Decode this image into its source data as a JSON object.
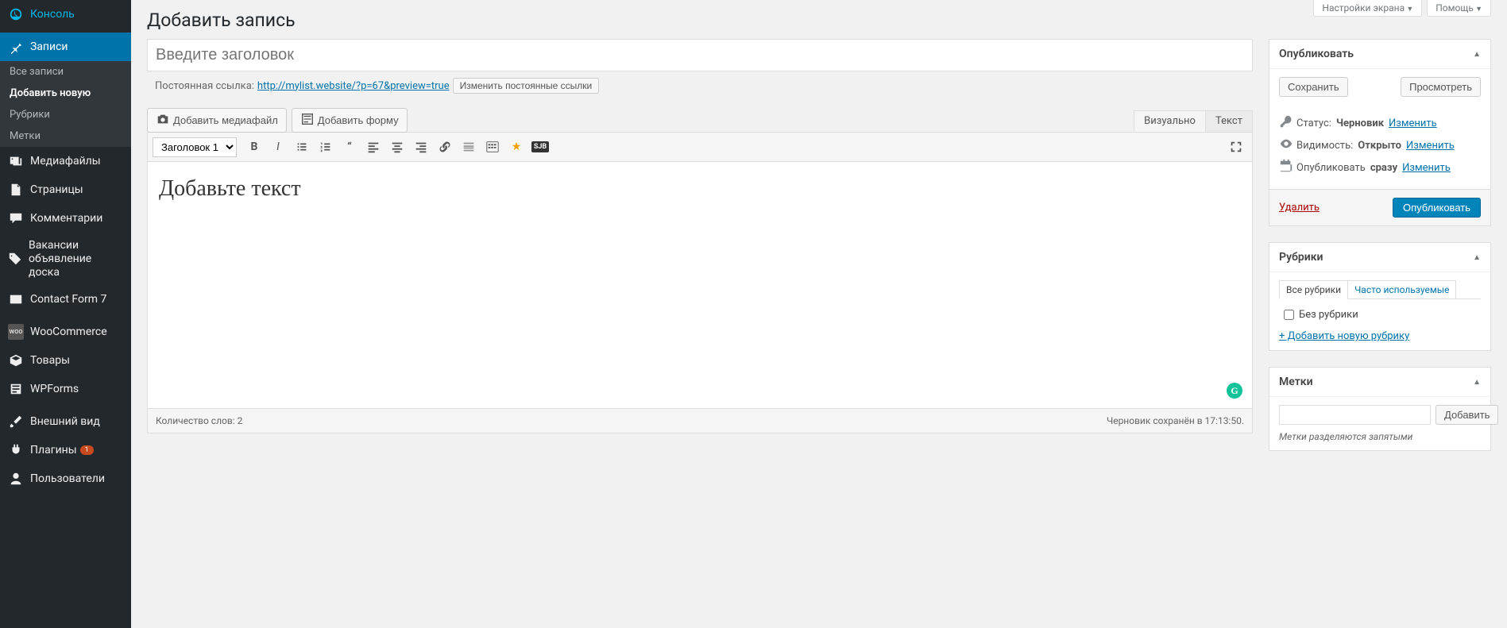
{
  "screen_meta": {
    "options": "Настройки экрана",
    "help": "Помощь"
  },
  "page_title": "Добавить запись",
  "sidebar": {
    "console": "Консоль",
    "posts": "Записи",
    "posts_sub": {
      "all": "Все записи",
      "add": "Добавить новую",
      "cats": "Рубрики",
      "tags": "Метки"
    },
    "media": "Медиафайлы",
    "pages": "Страницы",
    "comments": "Комментарии",
    "jobs": "Вакансии объявление доска",
    "cf7": "Contact Form 7",
    "woo": "WooCommerce",
    "products": "Товары",
    "wpforms": "WPForms",
    "appearance": "Внешний вид",
    "plugins": "Плагины",
    "plugins_badge": "1",
    "users": "Пользователи"
  },
  "title_placeholder": "Введите заголовок",
  "permalink": {
    "label": "Постоянная ссылка:",
    "url": "http://mylist.website/?p=67&preview=true",
    "edit_btn": "Изменить постоянные ссылки"
  },
  "media_buttons": {
    "add_media": "Добавить медиафайл",
    "add_form": "Добавить форму"
  },
  "editor_tabs": {
    "visual": "Визуально",
    "text": "Текст"
  },
  "format_select": "Заголовок 1",
  "editor_content": "Добавьте текст",
  "editor_status": {
    "words": "Количество слов: 2",
    "saved": "Черновик сохранён в 17:13:50."
  },
  "publish_box": {
    "title": "Опубликовать",
    "save": "Сохранить",
    "preview": "Просмотреть",
    "status_label": "Статус:",
    "status_value": "Черновик",
    "visibility_label": "Видимость:",
    "visibility_value": "Открыто",
    "schedule_label": "Опубликовать",
    "schedule_value": "сразу",
    "edit": "Изменить",
    "delete": "Удалить",
    "publish": "Опубликовать"
  },
  "categories_box": {
    "title": "Рубрики",
    "tab_all": "Все рубрики",
    "tab_used": "Часто используемые",
    "uncat": "Без рубрики",
    "add_new": "+ Добавить новую рубрику"
  },
  "tags_box": {
    "title": "Метки",
    "add": "Добавить",
    "hint": "Метки разделяются запятыми"
  }
}
